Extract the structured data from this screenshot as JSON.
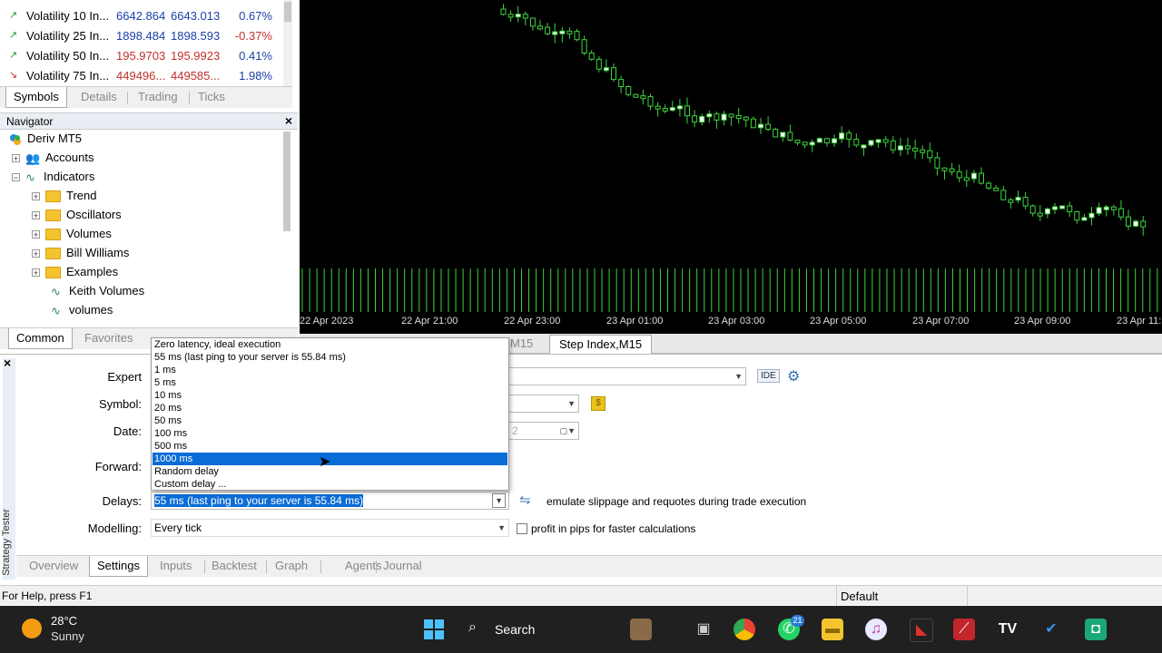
{
  "market_watch": {
    "rows": [
      {
        "dir": "up",
        "arrow": "↗",
        "name": "Volatility 10 In...",
        "bid": "6642.864",
        "ask": "6643.013",
        "chg": "0.67%"
      },
      {
        "dir": "up",
        "arrow": "↗",
        "name": "Volatility 25 In...",
        "bid": "1898.484",
        "ask": "1898.593",
        "chg": "-0.37%"
      },
      {
        "dir": "up",
        "arrow": "↗",
        "name": "Volatility 50 In...",
        "bid": "195.9703",
        "ask": "195.9923",
        "chg": "0.41%"
      },
      {
        "dir": "dn",
        "arrow": "↘",
        "name": "Volatility 75 In...",
        "bid": "449496...",
        "ask": "449585...",
        "chg": "1.98%"
      }
    ],
    "tabs": [
      "Symbols",
      "Details",
      "Trading",
      "Ticks"
    ]
  },
  "navigator": {
    "title": "Navigator",
    "close": "×",
    "items": {
      "root": "Deriv MT5",
      "accounts": "Accounts",
      "indicators": "Indicators",
      "trend": "Trend",
      "oscillators": "Oscillators",
      "volumes": "Volumes",
      "bill_williams": "Bill Williams",
      "examples": "Examples",
      "keith_volumes": "Keith Volumes",
      "volumes2": "volumes"
    },
    "tabs": [
      "Common",
      "Favorites"
    ]
  },
  "chart": {
    "x_ticks": [
      "22 Apr 2023",
      "22 Apr 21:00",
      "22 Apr 23:00",
      "23 Apr 01:00",
      "23 Apr 03:00",
      "23 Apr 05:00",
      "23 Apr 07:00",
      "23 Apr 09:00",
      "23 Apr 11:"
    ],
    "tabs": [
      "M15",
      "Step Index,M15"
    ],
    "colors": {
      "background": "#000000",
      "candle": "#3dd43d",
      "volume": "#3dd43d"
    }
  },
  "tester": {
    "side_label": "Strategy Tester",
    "close": "×",
    "labels": {
      "expert": "Expert",
      "symbol": "Symbol:",
      "date": "Date:",
      "forward": "Forward:",
      "delays": "Delays:",
      "modelling": "Modelling:"
    },
    "ide_label": "IDE",
    "date_fragment": "2",
    "delays_value": "55 ms (last ping to your server is 55.84 ms)",
    "modelling_value": "Every tick",
    "slippage_text": "emulate slippage and requotes during trade execution",
    "pips_text": "profit in pips for faster calculations",
    "dropdown_options": [
      "Zero latency, ideal execution",
      "55 ms (last ping to your server is 55.84 ms)",
      "1 ms",
      "5 ms",
      "10 ms",
      "20 ms",
      "50 ms",
      "100 ms",
      "500 ms",
      "1000 ms",
      "Random delay",
      "Custom delay ..."
    ],
    "dropdown_selected_index": 9,
    "tabs": [
      "Overview",
      "Settings",
      "Inputs",
      "Backtest",
      "Graph",
      "Agents",
      "Journal"
    ]
  },
  "status_bar": {
    "help": "For Help, press F1",
    "profile": "Default"
  },
  "taskbar": {
    "weather_temp": "28°C",
    "weather_desc": "Sunny",
    "search": "Search",
    "whatsapp_badge": "21"
  }
}
